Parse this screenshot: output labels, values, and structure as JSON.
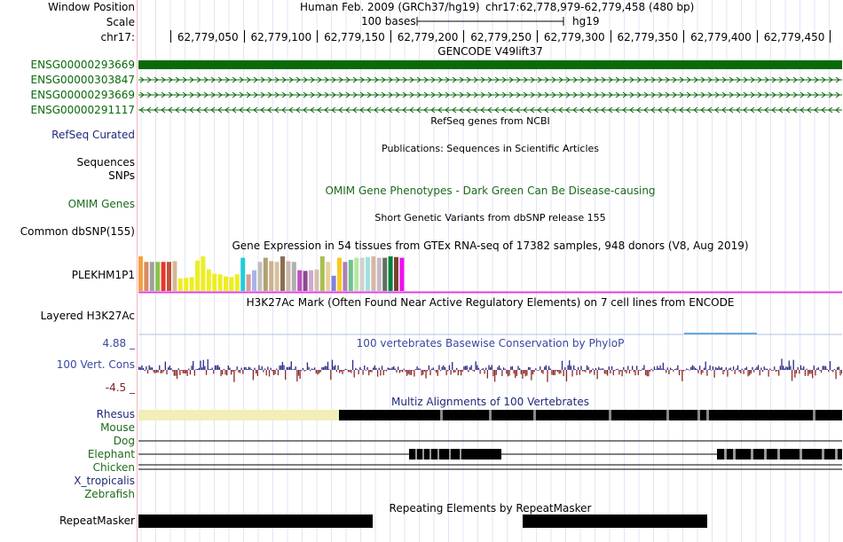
{
  "header": {
    "window_position_label": "Window Position",
    "scale_label": "Scale",
    "chrom_label": "chr17:",
    "assembly_text": "Human Feb. 2009 (GRCh37/hg19)",
    "position_text": "chr17:62,778,979-62,779,458 (480 bp)",
    "scale_text": "100 bases",
    "db_text": "hg19",
    "ruler_ticks": [
      "62,779,050",
      "62,779,100",
      "62,779,150",
      "62,779,200",
      "62,779,250",
      "62,779,300",
      "62,779,350",
      "62,779,400",
      "62,779,450"
    ]
  },
  "gencode": {
    "title": "GENCODE V49lift37",
    "genes": [
      {
        "name": "ENSG00000293669",
        "strand": "thick"
      },
      {
        "name": "ENSG00000303847",
        "strand": ">"
      },
      {
        "name": "ENSG00000293669",
        "strand": ">"
      },
      {
        "name": "ENSG00000291117",
        "strand": "<"
      }
    ]
  },
  "refseq": {
    "title": "RefSeq genes from NCBI",
    "label": "RefSeq Curated"
  },
  "publications": {
    "title": "Publications: Sequences in Scientific Articles",
    "label_sequences": "Sequences",
    "label_snps": "SNPs"
  },
  "omim": {
    "title": "OMIM Gene Phenotypes - Dark Green Can Be Disease-causing",
    "label": "OMIM Genes"
  },
  "dbsnp": {
    "title": "Short Genetic Variants from dbSNP release 155",
    "label": "Common dbSNP(155)"
  },
  "gtex": {
    "title": "Gene Expression in 54 tissues from GTEx RNA-seq of 17382 samples, 948 donors (V8, Aug 2019)",
    "label": "PLEKHM1P1",
    "bars": [
      {
        "color": "#f5a140",
        "value": 1.0
      },
      {
        "color": "#d98a60",
        "value": 0.84
      },
      {
        "color": "#a0a0a0",
        "value": 0.84
      },
      {
        "color": "#8bc34a",
        "value": 0.84
      },
      {
        "color": "#e8362e",
        "value": 0.84
      },
      {
        "color": "#c0503a",
        "value": 0.84
      },
      {
        "color": "#d4b896",
        "value": 0.86
      },
      {
        "color": "#eeee22",
        "value": 0.36
      },
      {
        "color": "#eeee22",
        "value": 0.38
      },
      {
        "color": "#eeee22",
        "value": 0.4
      },
      {
        "color": "#eeee22",
        "value": 0.88
      },
      {
        "color": "#eeee22",
        "value": 1.0
      },
      {
        "color": "#eeee22",
        "value": 0.62
      },
      {
        "color": "#eeee22",
        "value": 0.5
      },
      {
        "color": "#eeee22",
        "value": 0.48
      },
      {
        "color": "#eeee22",
        "value": 0.42
      },
      {
        "color": "#eeee22",
        "value": 0.4
      },
      {
        "color": "#eeee22",
        "value": 0.48
      },
      {
        "color": "#22ccd8",
        "value": 0.96
      },
      {
        "color": "#d89a9a",
        "value": 0.48
      },
      {
        "color": "#a8b4e8",
        "value": 0.6
      },
      {
        "color": "#c0c0c0",
        "value": 0.84
      },
      {
        "color": "#b0a070",
        "value": 0.96
      },
      {
        "color": "#cbb090",
        "value": 0.86
      },
      {
        "color": "#d8c0a0",
        "value": 0.84
      },
      {
        "color": "#8b6f50",
        "value": 1.0
      },
      {
        "color": "#c8b8a8",
        "value": 0.86
      },
      {
        "color": "#b0b0b0",
        "value": 0.84
      },
      {
        "color": "#c050c0",
        "value": 0.6
      },
      {
        "color": "#8c4b8c",
        "value": 0.58
      },
      {
        "color": "#d0a8d0",
        "value": 0.6
      },
      {
        "color": "#d4c0b0",
        "value": 0.62
      },
      {
        "color": "#a8c050",
        "value": 1.0
      },
      {
        "color": "#e8d0a0",
        "value": 0.84
      },
      {
        "color": "#8080e0",
        "value": 0.44
      },
      {
        "color": "#f5cc20",
        "value": 0.96
      },
      {
        "color": "#b080b0",
        "value": 0.84
      },
      {
        "color": "#70c090",
        "value": 0.9
      },
      {
        "color": "#b8e8a0",
        "value": 0.96
      },
      {
        "color": "#d0d0d0",
        "value": 0.96
      },
      {
        "color": "#a0e0e0",
        "value": 0.98
      },
      {
        "color": "#d6b8a0",
        "value": 1.0
      },
      {
        "color": "#c8b8c8",
        "value": 0.96
      },
      {
        "color": "#607060",
        "value": 0.96
      },
      {
        "color": "#008040",
        "value": 1.0
      },
      {
        "color": "#7a4030",
        "value": 0.98
      },
      {
        "color": "#ee10ee",
        "value": 0.96
      }
    ]
  },
  "h3k27ac": {
    "title": "H3K27Ac Mark (Often Found Near Active Regulatory Elements) on 7 cell lines from ENCODE",
    "label": "Layered H3K27Ac"
  },
  "phylop": {
    "title": "100 vertebrates Basewise Conservation by PhyloP",
    "label": "100 Vert. Cons",
    "max_label": "4.88 _",
    "min_label": "-4.5 _",
    "max": 4.88,
    "min": -4.5
  },
  "multiz": {
    "title": "Multiz Alignments of 100 Vertebrates",
    "species": [
      {
        "name": "Rhesus",
        "color": "#1f2a7a"
      },
      {
        "name": "Mouse",
        "color": "#1c6b1c"
      },
      {
        "name": "Dog",
        "color": "#1c6b1c"
      },
      {
        "name": "Elephant",
        "color": "#1c6b1c"
      },
      {
        "name": "Chicken",
        "color": "#1c6b1c"
      },
      {
        "name": "X_tropicalis",
        "color": "#1f2a7a"
      },
      {
        "name": "Zebrafish",
        "color": "#1c6b1c"
      }
    ]
  },
  "repeatmasker": {
    "title": "Repeating Elements by RepeatMasker",
    "label": "RepeatMasker"
  }
}
